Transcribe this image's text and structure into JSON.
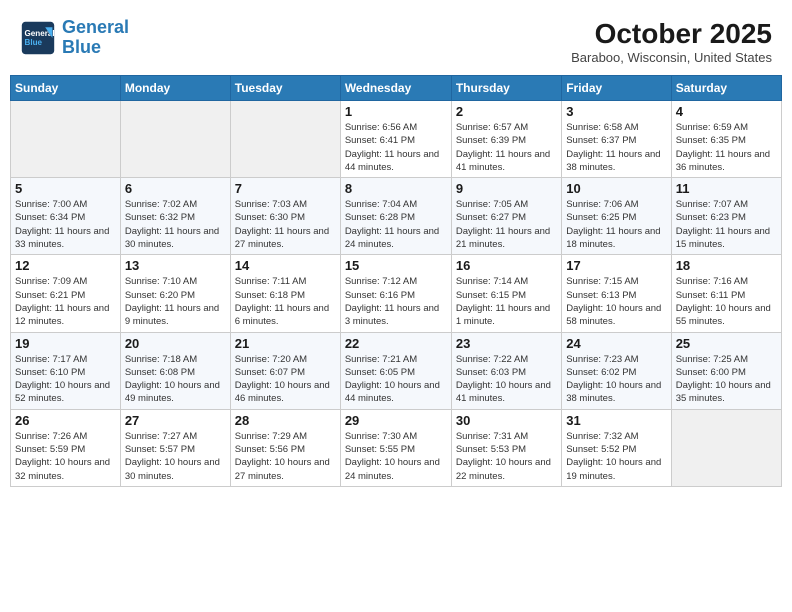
{
  "header": {
    "logo_line1": "General",
    "logo_line2": "Blue",
    "month": "October 2025",
    "location": "Baraboo, Wisconsin, United States"
  },
  "weekdays": [
    "Sunday",
    "Monday",
    "Tuesday",
    "Wednesday",
    "Thursday",
    "Friday",
    "Saturday"
  ],
  "rows": [
    {
      "cells": [
        {
          "day": "",
          "empty": true
        },
        {
          "day": "",
          "empty": true
        },
        {
          "day": "",
          "empty": true
        },
        {
          "day": "1",
          "sunrise": "6:56 AM",
          "sunset": "6:41 PM",
          "daylight": "11 hours and 44 minutes."
        },
        {
          "day": "2",
          "sunrise": "6:57 AM",
          "sunset": "6:39 PM",
          "daylight": "11 hours and 41 minutes."
        },
        {
          "day": "3",
          "sunrise": "6:58 AM",
          "sunset": "6:37 PM",
          "daylight": "11 hours and 38 minutes."
        },
        {
          "day": "4",
          "sunrise": "6:59 AM",
          "sunset": "6:35 PM",
          "daylight": "11 hours and 36 minutes."
        }
      ]
    },
    {
      "cells": [
        {
          "day": "5",
          "sunrise": "7:00 AM",
          "sunset": "6:34 PM",
          "daylight": "11 hours and 33 minutes."
        },
        {
          "day": "6",
          "sunrise": "7:02 AM",
          "sunset": "6:32 PM",
          "daylight": "11 hours and 30 minutes."
        },
        {
          "day": "7",
          "sunrise": "7:03 AM",
          "sunset": "6:30 PM",
          "daylight": "11 hours and 27 minutes."
        },
        {
          "day": "8",
          "sunrise": "7:04 AM",
          "sunset": "6:28 PM",
          "daylight": "11 hours and 24 minutes."
        },
        {
          "day": "9",
          "sunrise": "7:05 AM",
          "sunset": "6:27 PM",
          "daylight": "11 hours and 21 minutes."
        },
        {
          "day": "10",
          "sunrise": "7:06 AM",
          "sunset": "6:25 PM",
          "daylight": "11 hours and 18 minutes."
        },
        {
          "day": "11",
          "sunrise": "7:07 AM",
          "sunset": "6:23 PM",
          "daylight": "11 hours and 15 minutes."
        }
      ]
    },
    {
      "cells": [
        {
          "day": "12",
          "sunrise": "7:09 AM",
          "sunset": "6:21 PM",
          "daylight": "11 hours and 12 minutes."
        },
        {
          "day": "13",
          "sunrise": "7:10 AM",
          "sunset": "6:20 PM",
          "daylight": "11 hours and 9 minutes."
        },
        {
          "day": "14",
          "sunrise": "7:11 AM",
          "sunset": "6:18 PM",
          "daylight": "11 hours and 6 minutes."
        },
        {
          "day": "15",
          "sunrise": "7:12 AM",
          "sunset": "6:16 PM",
          "daylight": "11 hours and 3 minutes."
        },
        {
          "day": "16",
          "sunrise": "7:14 AM",
          "sunset": "6:15 PM",
          "daylight": "11 hours and 1 minute."
        },
        {
          "day": "17",
          "sunrise": "7:15 AM",
          "sunset": "6:13 PM",
          "daylight": "10 hours and 58 minutes."
        },
        {
          "day": "18",
          "sunrise": "7:16 AM",
          "sunset": "6:11 PM",
          "daylight": "10 hours and 55 minutes."
        }
      ]
    },
    {
      "cells": [
        {
          "day": "19",
          "sunrise": "7:17 AM",
          "sunset": "6:10 PM",
          "daylight": "10 hours and 52 minutes."
        },
        {
          "day": "20",
          "sunrise": "7:18 AM",
          "sunset": "6:08 PM",
          "daylight": "10 hours and 49 minutes."
        },
        {
          "day": "21",
          "sunrise": "7:20 AM",
          "sunset": "6:07 PM",
          "daylight": "10 hours and 46 minutes."
        },
        {
          "day": "22",
          "sunrise": "7:21 AM",
          "sunset": "6:05 PM",
          "daylight": "10 hours and 44 minutes."
        },
        {
          "day": "23",
          "sunrise": "7:22 AM",
          "sunset": "6:03 PM",
          "daylight": "10 hours and 41 minutes."
        },
        {
          "day": "24",
          "sunrise": "7:23 AM",
          "sunset": "6:02 PM",
          "daylight": "10 hours and 38 minutes."
        },
        {
          "day": "25",
          "sunrise": "7:25 AM",
          "sunset": "6:00 PM",
          "daylight": "10 hours and 35 minutes."
        }
      ]
    },
    {
      "cells": [
        {
          "day": "26",
          "sunrise": "7:26 AM",
          "sunset": "5:59 PM",
          "daylight": "10 hours and 32 minutes."
        },
        {
          "day": "27",
          "sunrise": "7:27 AM",
          "sunset": "5:57 PM",
          "daylight": "10 hours and 30 minutes."
        },
        {
          "day": "28",
          "sunrise": "7:29 AM",
          "sunset": "5:56 PM",
          "daylight": "10 hours and 27 minutes."
        },
        {
          "day": "29",
          "sunrise": "7:30 AM",
          "sunset": "5:55 PM",
          "daylight": "10 hours and 24 minutes."
        },
        {
          "day": "30",
          "sunrise": "7:31 AM",
          "sunset": "5:53 PM",
          "daylight": "10 hours and 22 minutes."
        },
        {
          "day": "31",
          "sunrise": "7:32 AM",
          "sunset": "5:52 PM",
          "daylight": "10 hours and 19 minutes."
        },
        {
          "day": "",
          "empty": true
        }
      ]
    }
  ]
}
